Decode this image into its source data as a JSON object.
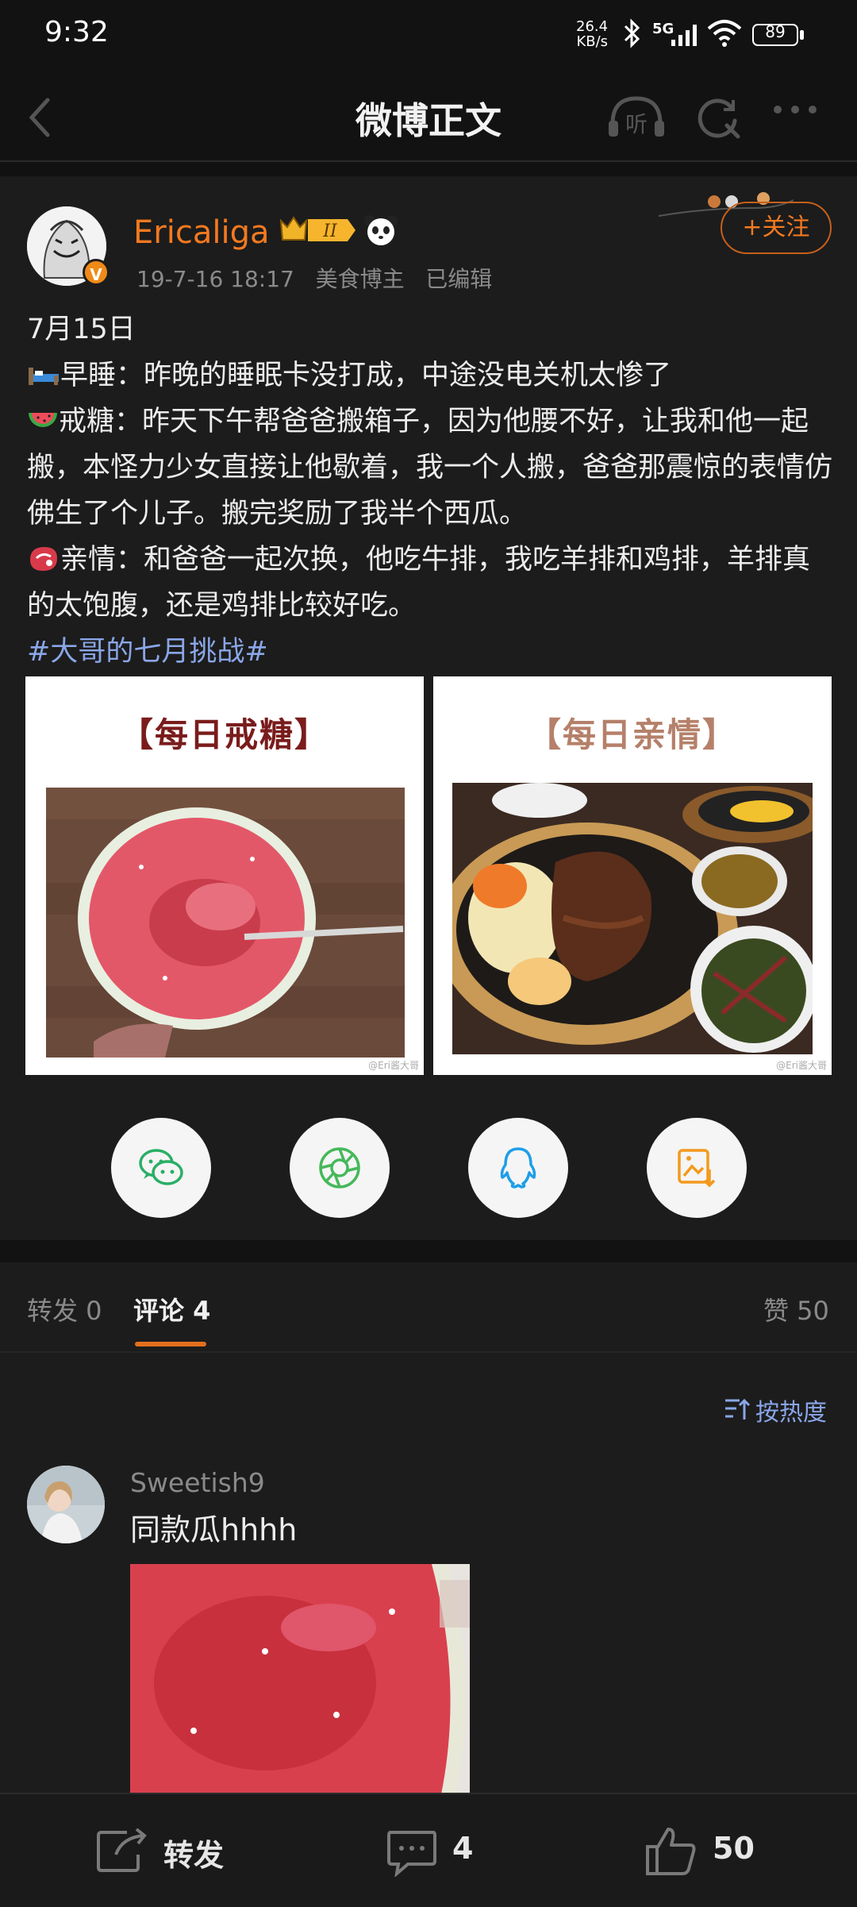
{
  "status_bar": {
    "time": "9:32",
    "speed_value": "26.4",
    "speed_unit": "KB/s",
    "network": "5G",
    "battery": "89"
  },
  "nav": {
    "title": "微博正文",
    "back_icon": "chevron-left-icon",
    "listen_label": "听",
    "refresh_icon": "refresh-search-icon",
    "more_icon": "more-dots-icon"
  },
  "post": {
    "username": "Ericaliga",
    "level_badge": "II",
    "meta": "19-7-16 18:17   美食博主   已编辑",
    "follow_label": "+关注",
    "line_date": "7月15日",
    "line1": "早睡：昨晚的睡眠卡没打成，中途没电关机太惨了",
    "line2": "戒糖：昨天下午帮爸爸搬箱子，因为他腰不好，让我和他一起搬，本怪力少女直接让他歇着，我一个人搬，爸爸那震惊的表情仿佛生了个儿子。搬完奖励了我半个西瓜。",
    "line3": "亲情：和爸爸一起次换，他吃牛排，我吃羊排和鸡排，羊排真的太饱腹，还是鸡排比较好吃。",
    "hashtag": "#大哥的七月挑战#",
    "image1_caption": "【每日戒糖】",
    "image2_caption": "【每日亲情】",
    "image_watermark": "@Eri酱大哥",
    "accent_color": "#f37920",
    "link_color": "#8aa6e8"
  },
  "share_targets": [
    "wechat-icon",
    "moments-icon",
    "qq-icon",
    "save-image-icon"
  ],
  "tabs": {
    "repost": "转发 0",
    "comments": "评论 4",
    "likes": "赞 50"
  },
  "sort_label": "按热度",
  "comment": {
    "author": "Sweetish9",
    "text": "同款瓜hhhh"
  },
  "bottom_bar": {
    "repost": "转发",
    "comment_count": "4",
    "like_count": "50"
  }
}
